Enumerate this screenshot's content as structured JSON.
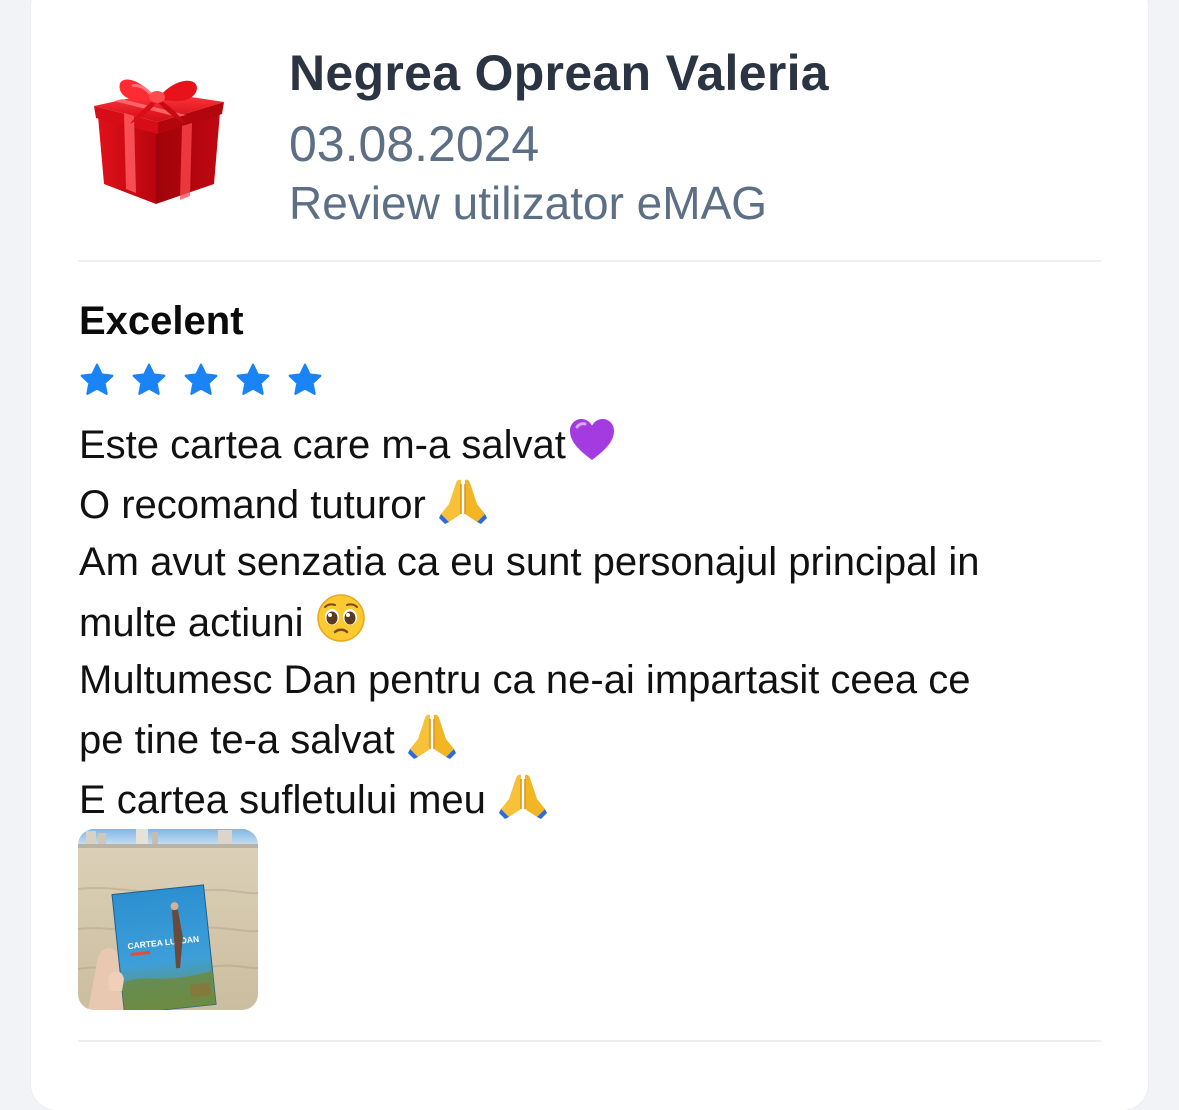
{
  "review": {
    "author": "Negrea Oprean Valeria",
    "date": "03.08.2024",
    "source": "Review utilizator eMAG",
    "title": "Excelent",
    "rating": 5,
    "rating_max": 5,
    "lines": [
      "Este cartea care m-a salvat",
      " O recomand tuturor ",
      " Am avut senzatia ca eu sunt personajul principal in",
      "multe actiuni ",
      " Multumesc Dan pentru ca ne-ai impartasit ceea ce",
      "pe tine te-a salvat ",
      " E cartea sufletului meu "
    ],
    "emojis": {
      "line1": "purple-heart-icon",
      "line2": "folded-hands-icon",
      "line4": "pleading-face-icon",
      "line6": "folded-hands-icon",
      "line7": "folded-hands-icon"
    },
    "avatar_icon": "gift-box-icon",
    "photo": {
      "name": "review-photo-thumbnail",
      "book_title": "CARTEA LUI DAN"
    }
  },
  "colors": {
    "star": "#1a83f5",
    "author": "#2b3442",
    "meta": "#5d6f85",
    "divider": "#eef0f3"
  }
}
